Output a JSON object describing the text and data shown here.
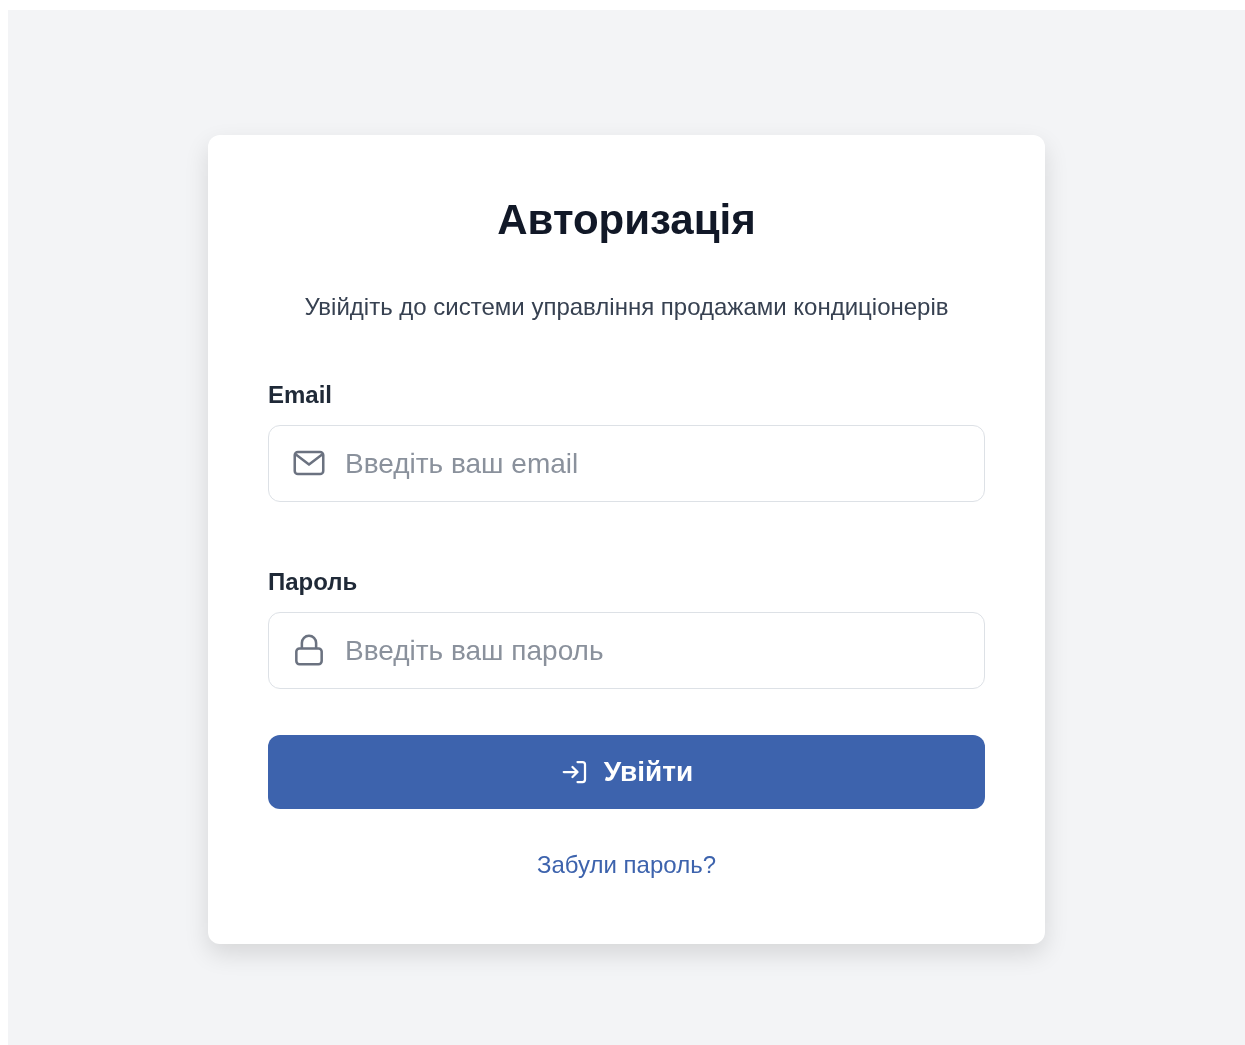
{
  "title": "Авторизація",
  "subtitle": "Увійдіть до системи управління продажами кондиціонерів",
  "fields": [
    {
      "kind": "email",
      "label": "Email",
      "placeholder": "Введіть ваш email"
    },
    {
      "kind": "password",
      "label": "Пароль",
      "placeholder": "Введіть ваш пароль"
    }
  ],
  "submit_button": {
    "label": "Увійти"
  },
  "forgot_link": "Забули пароль?"
}
